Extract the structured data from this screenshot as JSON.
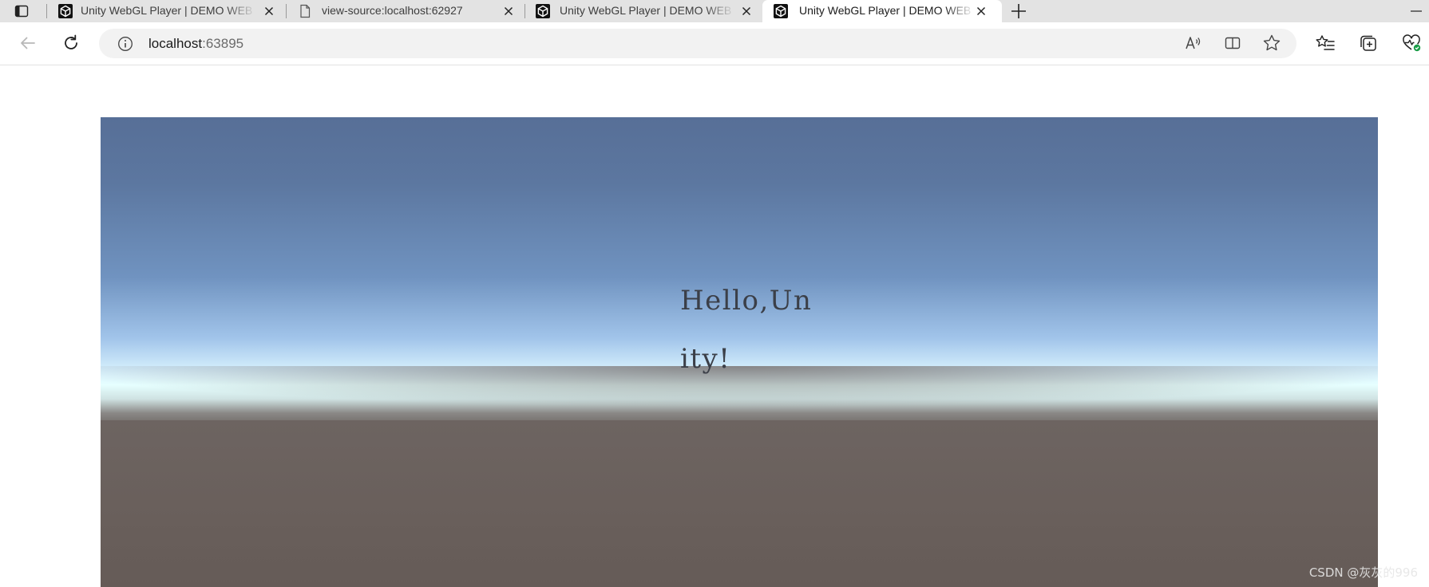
{
  "browser": {
    "tabs": [
      {
        "title": "Unity WebGL Player | DEMO WEB",
        "icon": "unity-icon",
        "active": false
      },
      {
        "title": "view-source:localhost:62927",
        "icon": "page-icon",
        "active": false
      },
      {
        "title": "Unity WebGL Player | DEMO WEB",
        "icon": "unity-icon",
        "active": false
      },
      {
        "title": "Unity WebGL Player | DEMO WEB",
        "icon": "unity-icon",
        "active": true
      }
    ],
    "address_bar": {
      "host": "localhost",
      "port": ":63895"
    }
  },
  "unity": {
    "text": "Hello,Unity!",
    "colors": {
      "sky_top": "#576f97",
      "sky_horizon": "#e6ffff",
      "ground": "#685f5b",
      "text": "#3b3f48"
    }
  },
  "watermark": "CSDN @灰灰的996"
}
